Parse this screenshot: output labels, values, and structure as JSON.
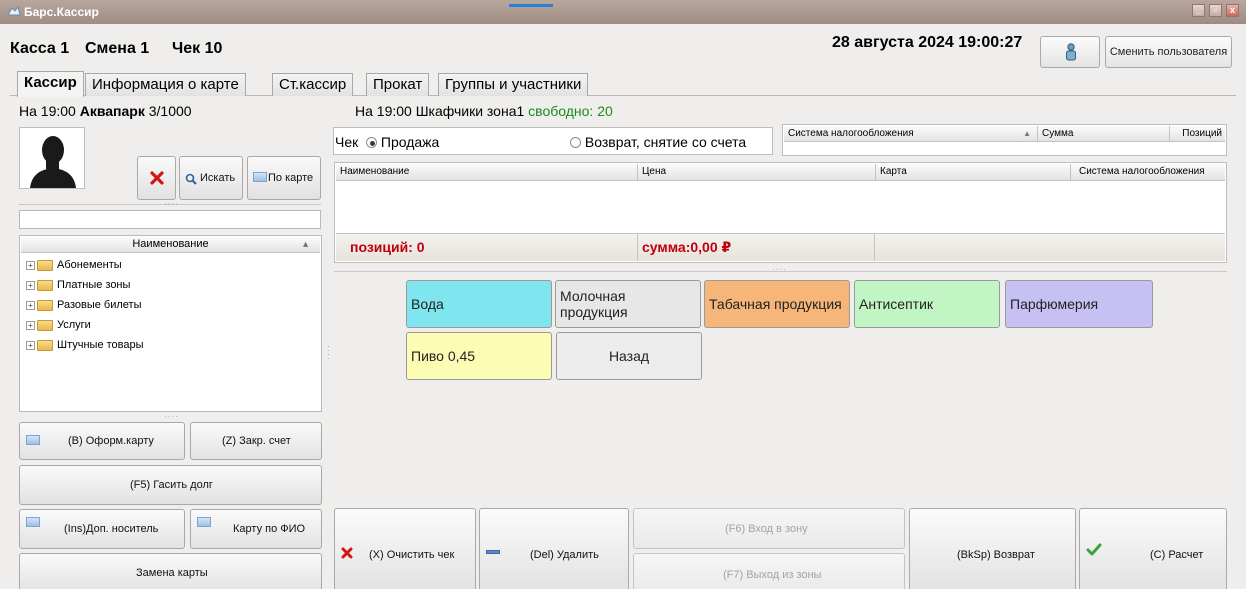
{
  "window": {
    "title": "Барс.Кассир",
    "minimize": "_",
    "maximize": "▫",
    "close": "x"
  },
  "header": {
    "kassa": "Касса 1",
    "smena": "Смена 1",
    "chek": "Чек 10",
    "datetime": "28 августа 2024 19:00:27",
    "switch_user": "Сменить пользователя"
  },
  "tabs": [
    {
      "label": "Кассир",
      "active": true
    },
    {
      "label": "Информация о карте"
    },
    {
      "label": "Ст.кассир"
    },
    {
      "label": "Прокат"
    },
    {
      "label": "Группы и участники"
    }
  ],
  "left": {
    "status_prefix": "На 19:00",
    "status_name": "Аквапарк",
    "status_value": "3/1000",
    "buttons": {
      "search": "Искать",
      "by_card": "По карте"
    },
    "search_value": "",
    "tree": {
      "header": "Наименование",
      "items": [
        "Абонементы",
        "Платные зоны",
        "Разовые билеты",
        "Услуги",
        "Штучные товары"
      ]
    },
    "actions": {
      "issue_card": "(B) Оформ.карту",
      "close_account": "(Z) Закр. счет",
      "pay_debt": "(F5) Гасить долг",
      "add_carrier": "(Ins)Доп. носитель",
      "card_by_name": "Карту по ФИО",
      "replace_card": "Замена карты"
    }
  },
  "right": {
    "status_text": "На 19:00 Шкафчики зона1",
    "status_free": "свободно: 20",
    "check": {
      "label": "Чек",
      "sale": "Продажа",
      "refund": "Возврат, снятие со счета"
    },
    "tax_table": {
      "columns": [
        "Система налогообложения",
        "Сумма",
        "Позиций"
      ]
    },
    "grid": {
      "columns": [
        "Наименование",
        "Цена",
        "Карта",
        "Система налогообложения"
      ],
      "positions": "позиций: 0",
      "sum": "сумма:0,00 ₽"
    }
  },
  "products": [
    {
      "label": "Вода",
      "color": "#7fe5ef"
    },
    {
      "label": "Молочная продукция",
      "color": "#e7e7e7"
    },
    {
      "label": "Табачная продукция",
      "color": "#f7b679"
    },
    {
      "label": "Антисептик",
      "color": "#c2f5c4"
    },
    {
      "label": "Парфюмерия",
      "color": "#c6c0f3"
    },
    {
      "label": "Пиво 0,45",
      "color": "#fdfcb4"
    },
    {
      "label": "Назад",
      "color": "#ececec"
    }
  ],
  "bottom": {
    "clear": "(X) Очистить чек",
    "delete": "(Del) Удалить",
    "enter_zone": "(F6) Вход в зону",
    "exit_zone": "(F7) Выход из зоны",
    "refund": "(BkSp) Возврат",
    "pay": "(C) Расчет"
  },
  "colors": {
    "free_green": "#1c8a1c",
    "total_red": "#c0000c",
    "delete_red": "#d11616",
    "ok_green": "#3da13d"
  }
}
